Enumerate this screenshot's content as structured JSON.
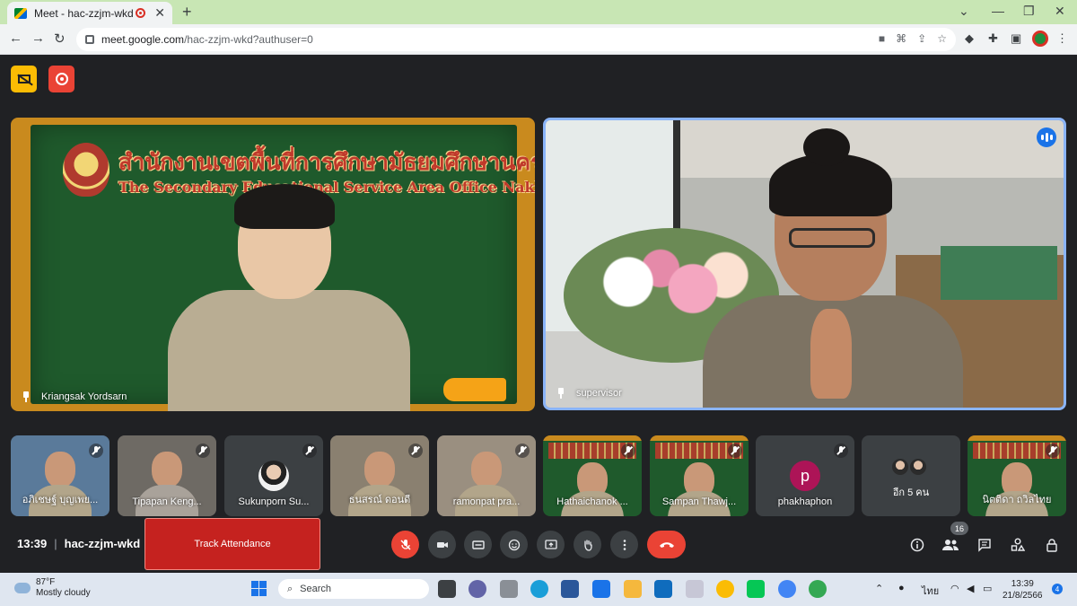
{
  "browser": {
    "tab_title": "Meet - hac-zzjm-wkd",
    "tab_close": "✕",
    "new_tab": "+",
    "url_host": "meet.google.com",
    "url_path": "/hac-zzjm-wkd?authuser=0",
    "minimize": "⌄",
    "restore": "—",
    "maximize": "❐",
    "close": "✕"
  },
  "main_tiles": [
    {
      "name": "Kriangsak Yordsarn",
      "board_title_th": "สำนักงานเขตพื้นที่การศึกษามัธยมศึกษานครสวรรค์",
      "board_title_en": "The Secondary Educational Service Area Office Nakhon Sawan"
    },
    {
      "name": "supervisor"
    }
  ],
  "thumbnails": [
    {
      "name": "อภิเชษฐ์ บุญเพย...",
      "bg": "#5a7a9a"
    },
    {
      "name": "Tipapan Keng...",
      "bg": "#6e6a64"
    },
    {
      "name": "Sukunporn Su...",
      "bg": "#3c4043"
    },
    {
      "name": "ธนสรณ์ ดอนดี",
      "bg": "#8a8070"
    },
    {
      "name": "ramonpat pra...",
      "bg": "#9a8f80"
    },
    {
      "name": "Hathaichanok ...",
      "bg": "#1f5a2c"
    },
    {
      "name": "Sampan Thawj...",
      "bg": "#1f5a2c"
    },
    {
      "name": "phakhaphon",
      "letter": "p"
    },
    {
      "more_label": "อีก 5 คน"
    },
    {
      "name": "นิตติดา ถวิลไทย",
      "bg": "#1f5a2c"
    }
  ],
  "bottom_bar": {
    "time": "13:39",
    "meeting_code": "hac-zzjm-wkd",
    "track_attendance": "Track Attendance",
    "participant_count": "16"
  },
  "colors": {
    "meet_bg": "#202124",
    "accent_red": "#ea4335",
    "active_speaker_border": "#8ab4f8",
    "track_button": "#c5221f"
  },
  "taskbar": {
    "temperature": "87°F",
    "weather": "Mostly cloudy",
    "search_label": "Search",
    "language": "ไทย",
    "clock_time": "13:39",
    "clock_date": "21/8/2566",
    "notifications": "4"
  },
  "icons": {
    "meet_top": [
      "no-capture-icon",
      "recording-icon"
    ],
    "controls": [
      "mic-off-icon",
      "camera-icon",
      "captions-icon",
      "emoji-icon",
      "present-icon",
      "raise-hand-icon",
      "more-options-icon",
      "hang-up-icon"
    ],
    "right_controls": [
      "info-icon",
      "people-icon",
      "chat-icon",
      "activities-icon",
      "host-controls-icon"
    ]
  }
}
